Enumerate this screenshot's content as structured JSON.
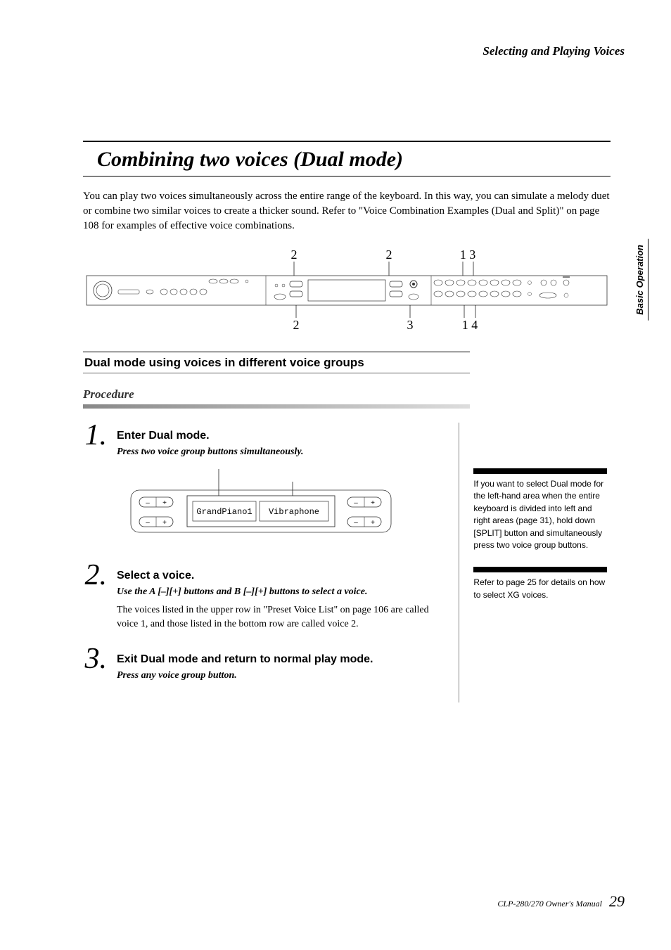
{
  "header": {
    "section": "Selecting and Playing Voices"
  },
  "side_tab": "Basic Operation",
  "title": "Combining two voices (Dual mode)",
  "intro": "You can play two voices simultaneously across the entire range of the keyboard. In this way, you can simulate a melody duet or combine two similar voices to create a thicker sound. Refer to \"Voice Combination Examples (Dual and Split)\" on page 108 for examples of effective voice combinations.",
  "diagram_numbers": {
    "top": [
      "2",
      "2",
      "1 3"
    ],
    "bottom": [
      "2",
      "3",
      "1 4"
    ]
  },
  "subhead": "Dual mode using voices in different voice groups",
  "procedure_label": "Procedure",
  "steps": [
    {
      "num": "1.",
      "title": "Enter Dual mode.",
      "sub": "Press two voice group buttons simultaneously.",
      "text": "",
      "lcd": {
        "voice1": "GrandPiano1",
        "voice2": "Vibraphone"
      }
    },
    {
      "num": "2.",
      "title": "Select a voice.",
      "sub": "Use the A [–][+] buttons and B [–][+] buttons to select a voice.",
      "text": "The voices listed in the upper row in \"Preset Voice List\" on page 106 are called voice 1, and those listed in the bottom row are called voice 2."
    },
    {
      "num": "3.",
      "title": "Exit Dual mode and return to normal play mode.",
      "sub": "Press any voice group button.",
      "text": ""
    }
  ],
  "tips": [
    "If you want to select Dual mode for the left-hand area when the entire keyboard is divided into left and right areas (page 31), hold down [SPLIT] button and simultaneously press two voice group buttons.",
    "Refer to page 25 for details on how to select XG voices."
  ],
  "footer": {
    "manual": "CLP-280/270 Owner's Manual",
    "page": "29"
  }
}
